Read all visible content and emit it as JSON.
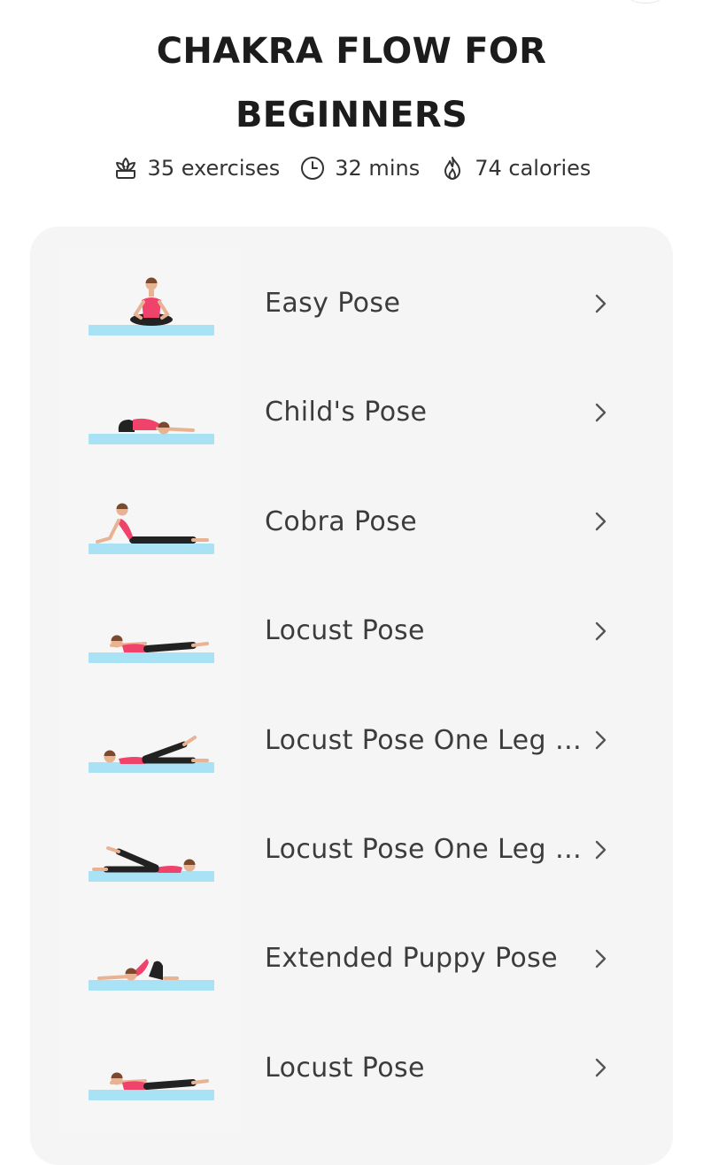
{
  "workout": {
    "title_line1": "CHAKRA FLOW FOR",
    "title_line2": "BEGINNERS",
    "exercises": "35 exercises",
    "duration": "32 mins",
    "calories": "74 calories"
  },
  "icons": {
    "exercises": "lotus-icon",
    "duration": "clock-icon",
    "calories": "flame-icon",
    "row": "chevron-right-icon"
  },
  "colors": {
    "mat": "#a9e2f4",
    "top": "#f0436b",
    "pants": "#222222",
    "skin": "#e8b392",
    "hair": "#7b4a2e"
  },
  "exercises": [
    {
      "name": "Easy Pose",
      "pose": "easy"
    },
    {
      "name": "Child's Pose",
      "pose": "child"
    },
    {
      "name": "Cobra Pose",
      "pose": "cobra"
    },
    {
      "name": "Locust Pose",
      "pose": "locust"
    },
    {
      "name": "Locust Pose One Leg U...",
      "pose": "locust-leg-right"
    },
    {
      "name": "Locust Pose One Leg U...",
      "pose": "locust-leg-left"
    },
    {
      "name": "Extended Puppy Pose",
      "pose": "puppy"
    },
    {
      "name": "Locust Pose",
      "pose": "locust"
    }
  ]
}
